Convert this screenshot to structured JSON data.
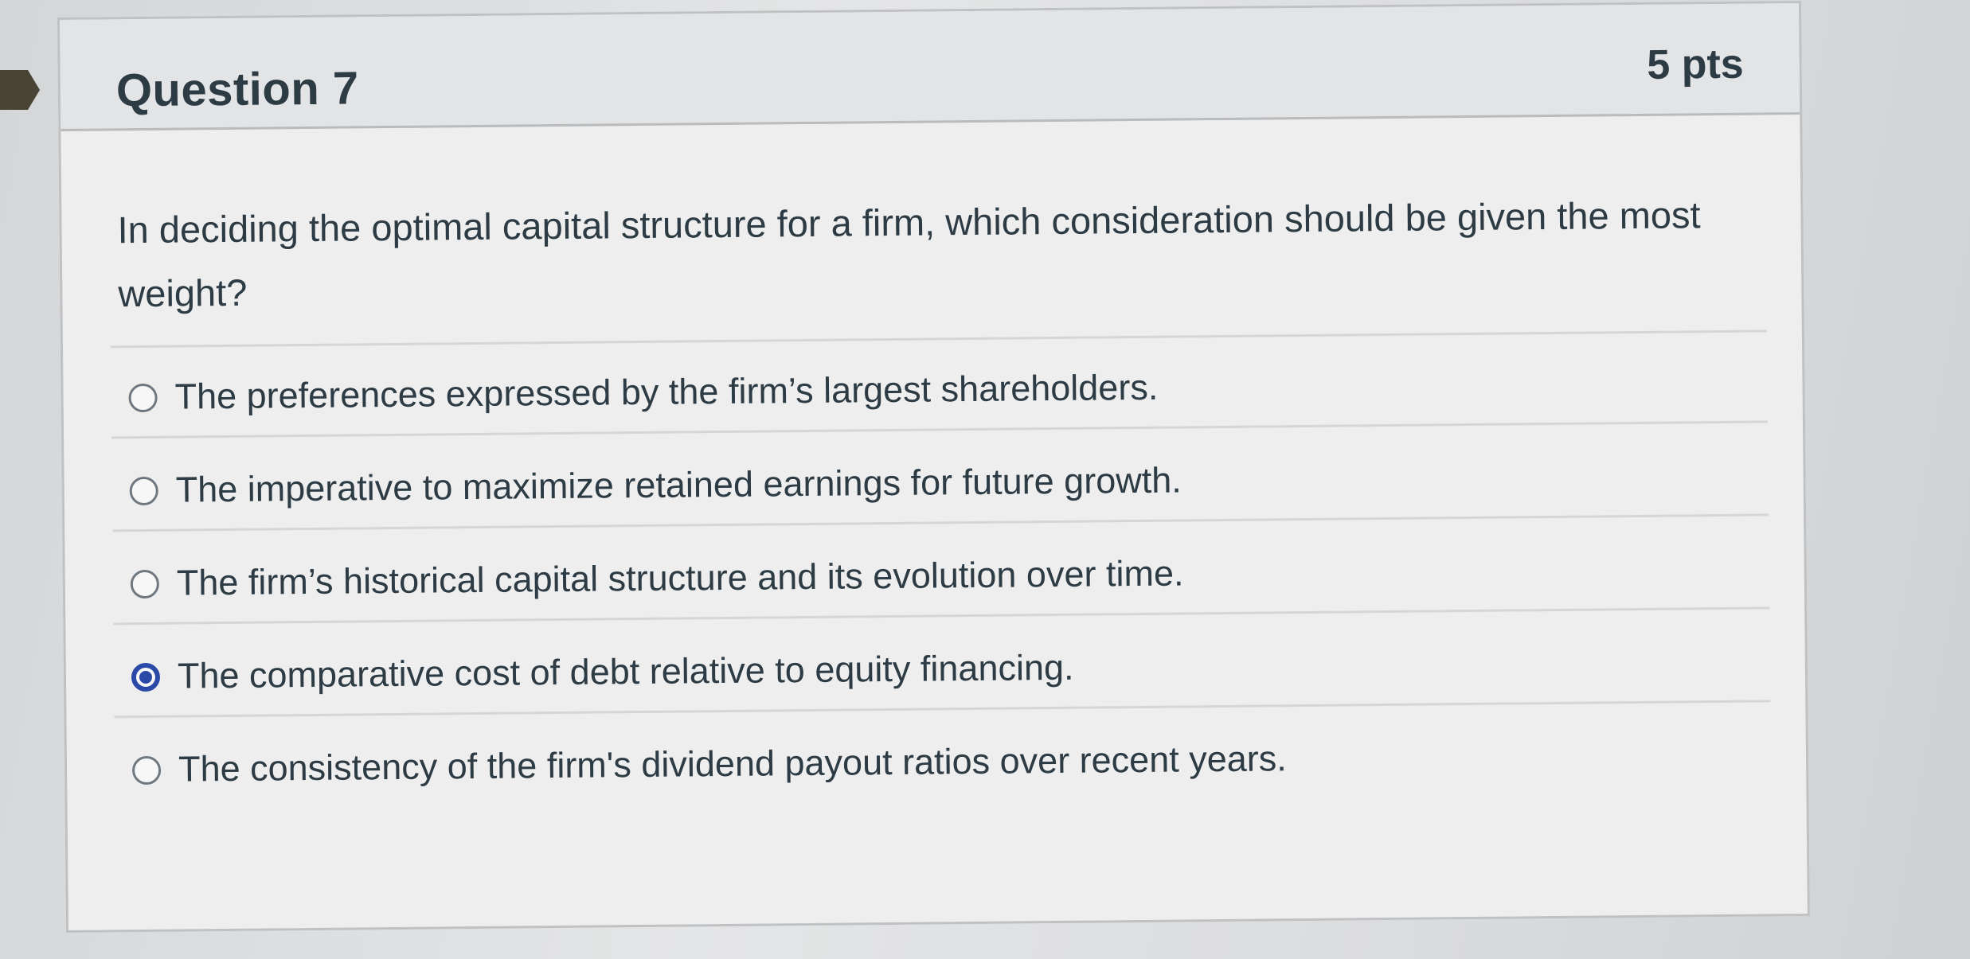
{
  "question": {
    "title": "Question 7",
    "points": "5 pts",
    "text": "In deciding the optimal capital structure for a firm, which consideration should be given the most weight?",
    "answers": [
      {
        "label": "The preferences expressed by the firm’s largest shareholders.",
        "selected": false
      },
      {
        "label": "The imperative to maximize retained earnings for future growth.",
        "selected": false
      },
      {
        "label": "The firm’s historical capital structure and its evolution over time.",
        "selected": false
      },
      {
        "label": "The comparative cost of debt relative to equity financing.",
        "selected": true
      },
      {
        "label": "The consistency of the firm's dividend payout ratios over recent years.",
        "selected": false
      }
    ]
  },
  "colors": {
    "accent": "#2b4aa8",
    "text": "#2d3b45",
    "header_bg": "#e3e4e5"
  }
}
